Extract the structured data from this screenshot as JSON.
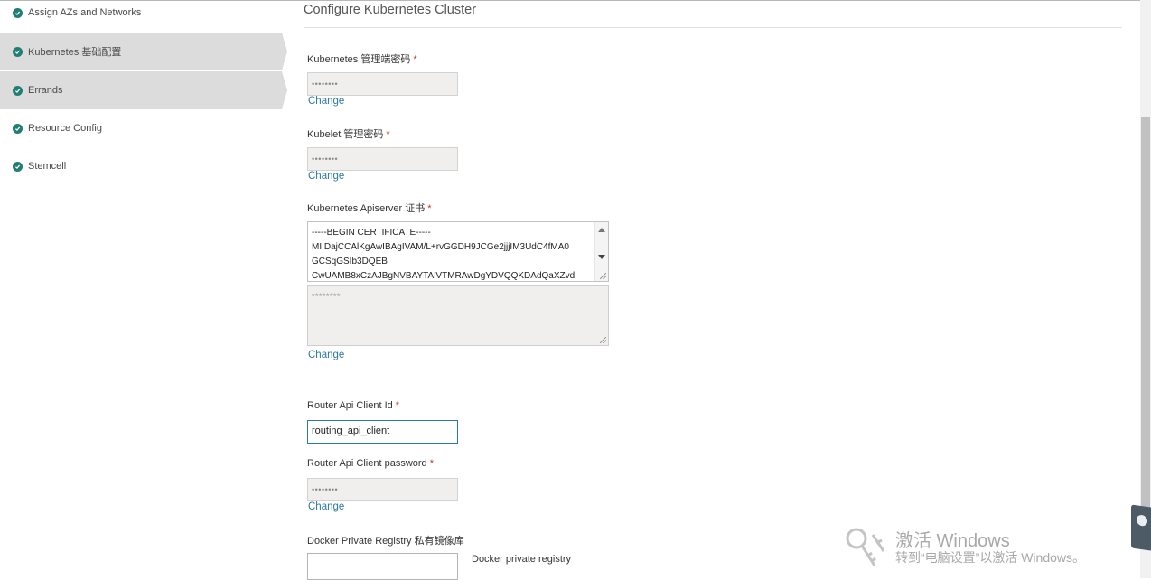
{
  "sidebar": {
    "items": [
      {
        "label": "Assign AZs and Networks",
        "status": "complete"
      },
      {
        "label": "Kubernetes 基础配置",
        "status": "complete",
        "active": true
      },
      {
        "label": "Errands",
        "status": "complete",
        "active": true
      },
      {
        "label": "Resource Config",
        "status": "complete"
      },
      {
        "label": "Stemcell",
        "status": "complete"
      }
    ]
  },
  "main": {
    "title": "Configure Kubernetes Cluster",
    "required_marker": "*",
    "change_label": "Change",
    "fields": {
      "k8s_admin_password": {
        "label": "Kubernetes 管理端密码",
        "masked": "••••••••"
      },
      "kubelet_password": {
        "label": "Kubelet 管理密码",
        "masked": "••••••••"
      },
      "apiserver_cert": {
        "label": "Kubernetes Apiserver 证书",
        "lines": [
          "-----BEGIN CERTIFICATE-----",
          "MIIDajCCAlKgAwIBAgIVAM/L+rvGGDH9JCGe2jjjIM3UdC4fMA0",
          "GCSqGSIb3DQEB",
          "CwUAMB8xCzAJBgNVBAYTAlVTMRAwDgYDVQQKDAdQaXZvd"
        ],
        "private_key_masked": "********"
      },
      "router_api_client_id": {
        "label": "Router Api Client Id",
        "value": "routing_api_client"
      },
      "router_api_client_password": {
        "label": "Router Api Client password",
        "masked": "••••••••"
      },
      "docker_private_registry": {
        "label": "Docker Private Registry 私有镜像库",
        "hint": "Docker private registry",
        "value": ""
      }
    }
  },
  "watermark": {
    "title": "激活 Windows",
    "subtitle": "转到“电脑设置”以激活 Windows。"
  },
  "colors": {
    "accent": "#2b78a6",
    "check": "#1f7f73",
    "active_bg": "#dcdcdc",
    "required": "#c0392b"
  }
}
